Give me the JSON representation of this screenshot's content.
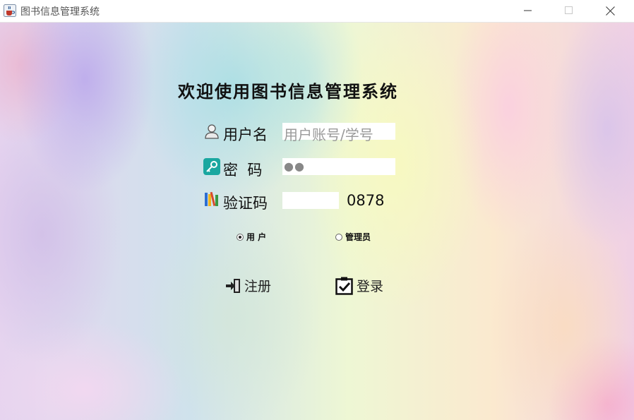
{
  "window": {
    "title": "图书信息管理系统",
    "app_icon": "java-cup-icon",
    "controls": [
      "minimize-icon",
      "maximize-icon",
      "close-icon"
    ]
  },
  "main": {
    "welcome": "欢迎使用图书信息管理系统",
    "username": {
      "label": "用户名",
      "placeholder": "用户账号/学号",
      "value": "",
      "icon": "user-icon"
    },
    "password": {
      "label": "密  码",
      "masked_value": "●●",
      "icon": "key-icon"
    },
    "captcha": {
      "label": "验证码",
      "value": "",
      "code": "0878",
      "icon": "books-icon"
    },
    "roles": {
      "options": [
        "用 户",
        "管理员"
      ],
      "selected": "用 户"
    },
    "actions": {
      "register": {
        "label": "注册",
        "icon": "sign-in-icon"
      },
      "login": {
        "label": "登录",
        "icon": "checkbox-icon"
      }
    }
  }
}
